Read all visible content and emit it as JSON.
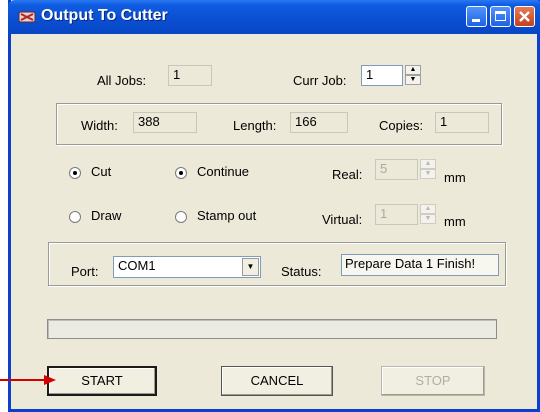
{
  "window": {
    "title": "Output To Cutter"
  },
  "jobs": {
    "all_label": "All Jobs:",
    "all_value": "1",
    "curr_label": "Curr Job:",
    "curr_value": "1"
  },
  "dimensions": {
    "width_label": "Width:",
    "width_value": "388",
    "length_label": "Length:",
    "length_value": "166",
    "copies_label": "Copies:",
    "copies_value": "1"
  },
  "mode": {
    "cut_label": "Cut",
    "cut_selected": true,
    "draw_label": "Draw",
    "draw_selected": false,
    "continue_label": "Continue",
    "continue_selected": true,
    "stamp_label": "Stamp out",
    "stamp_selected": false
  },
  "offsets": {
    "real_label": "Real:",
    "real_value": "5",
    "real_unit": "mm",
    "virtual_label": "Virtual:",
    "virtual_value": "1",
    "virtual_unit": "mm"
  },
  "port": {
    "label": "Port:",
    "value": "COM1",
    "status_label": "Status:",
    "status_value": "Prepare Data 1 Finish!"
  },
  "progress": {
    "fraction": 0
  },
  "buttons": {
    "start": "START",
    "cancel": "CANCEL",
    "stop": "STOP"
  },
  "colors": {
    "titlebar": "#0a4fd4",
    "dialog_bg": "#ece9d8",
    "arrow": "#d40000"
  }
}
